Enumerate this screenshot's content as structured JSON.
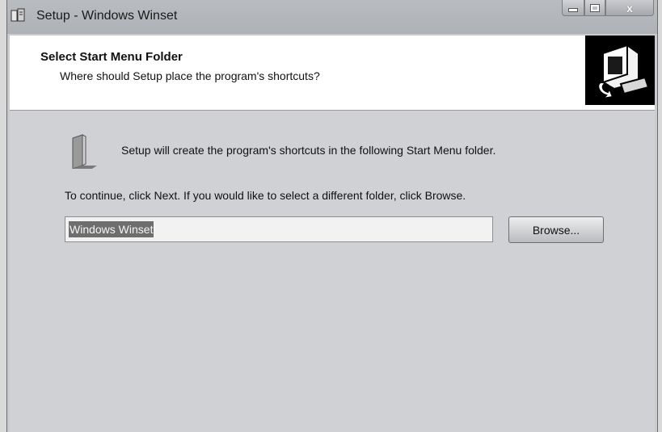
{
  "window": {
    "title": "Setup - Windows Winset"
  },
  "titlebar_buttons": {
    "minimize_icon": "minimize-icon",
    "maximize_icon": "maximize-icon",
    "close_label": "x"
  },
  "header": {
    "title": "Select Start Menu Folder",
    "subtitle": "Where should Setup place the program's shortcuts?",
    "logo_icon": "computer-setup-icon"
  },
  "content": {
    "folder_icon": "folder-icon",
    "info_text": "Setup will create the program's shortcuts in the following Start Menu folder.",
    "continue_text": "To continue, click Next. If you would like to select a different folder, click Browse.",
    "folder_input_value": "Windows Winset",
    "browse_label": "Browse..."
  }
}
